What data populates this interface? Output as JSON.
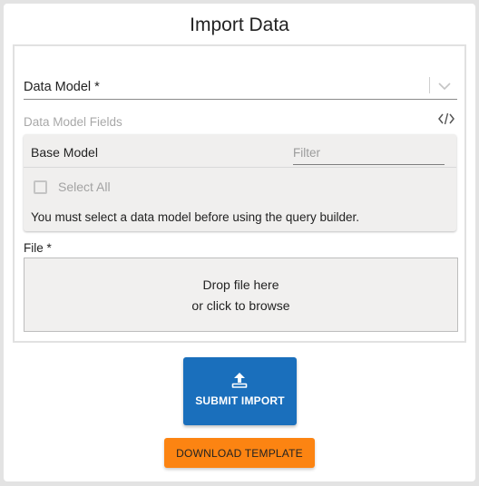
{
  "dialog": {
    "title": "Import Data"
  },
  "data_model": {
    "label": "Data Model *",
    "value": "",
    "dropdown_icon": "chevron-down-icon"
  },
  "data_model_fields": {
    "label": "Data Model Fields",
    "toggle_icon": "code-icon"
  },
  "query_builder": {
    "base_model_label": "Base Model",
    "filter_placeholder": "Filter",
    "select_all_label": "Select All",
    "select_all_checked": false,
    "message": "You must select a data model before using the query builder."
  },
  "file": {
    "label": "File *",
    "drop_line1": "Drop file here",
    "drop_line2": "or click to browse"
  },
  "actions": {
    "submit_label": "SUBMIT IMPORT",
    "submit_icon": "upload-icon",
    "download_label": "DOWNLOAD TEMPLATE"
  },
  "colors": {
    "primary": "#1a6fbc",
    "accent": "#fc8412",
    "background": "#e3e3e3",
    "panel_bg": "#f0efee"
  }
}
